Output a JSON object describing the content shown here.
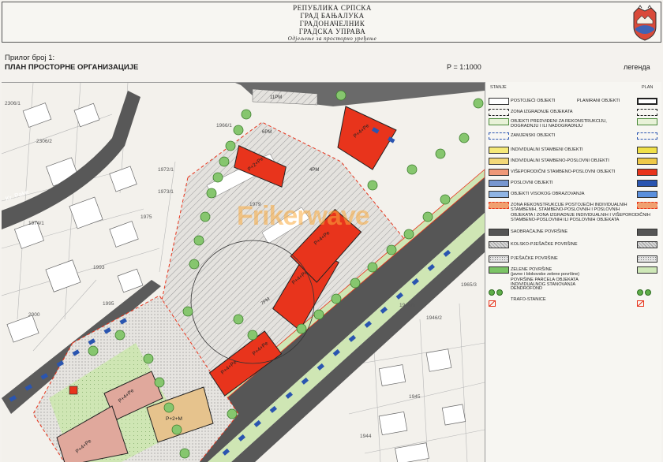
{
  "header": {
    "line1": "РЕПУБЛИКА СРПСКА",
    "line2": "ГРАД БАЊАЛУКА",
    "line3": "ГРАДОНАЧЕЛНИК",
    "line4": "ГРАДСКА УПРАВА",
    "line5": "Одјељење за просторно уређење"
  },
  "sheet": {
    "attachment": "Прилог број 1:",
    "title": "ПЛАН ПРОСТОРНЕ ОРГАНИЗАЦИЈЕ",
    "scale": "Р = 1:1000",
    "legend_label": "легенда"
  },
  "watermark": "Frikerwave",
  "map": {
    "parcels": [
      "2306/1",
      "2306/2",
      "1966/1",
      "1972/1",
      "1973/1",
      "1975",
      "1974/1",
      "1993",
      "1995",
      "2000",
      "1979",
      "1965/3",
      "1949/1",
      "1945",
      "1944",
      "1946/2"
    ],
    "street_label": "Kr. Pake",
    "building_labels": [
      "P+4+Pe",
      "P+2+Pe",
      "P+4+Pe",
      "P+4+Pe",
      "P+4+Pe",
      "P+4+Pe",
      "P+2+M",
      "P+4+Pe",
      "P+4+Pe"
    ],
    "parking_label": "11PM",
    "parking_label_2": "6PM",
    "parking_label_3": "4PM",
    "parking_label_4": "7PM"
  },
  "legend": {
    "col_existing": "STANJE",
    "col_plan": "PLAN",
    "items": [
      {
        "label": "POSTOJEĆI OBJEKTI",
        "label2": "PLANIRANI OBJEKTI",
        "fill": "#ffffff",
        "fill2": "#ffffff",
        "style": "outline"
      },
      {
        "label": "ZONA IZGRADNJE OBJEKATA",
        "fill": "none",
        "style": "dashed"
      },
      {
        "label": "OBJEKTI PREDVIĐENI ZA REKONSTRUKCIJU,\nDOGRADNJU I ILI NADOGRADNJU",
        "fill": "#e8f2d8",
        "style": "green-outline"
      },
      {
        "label": "ZAMJENSKI OBJEKTI",
        "fill": "none",
        "style": "blue-dashed"
      },
      {
        "label": "INDIVIDUALNI STAMBENI OBJEKTI",
        "fill": "#f5e978",
        "fill2": "#f0e048"
      },
      {
        "label": "INDIVIDUALNI STAMBENO-POSLOVNI OBJEKTI",
        "fill": "#f3d878",
        "fill2": "#eec848"
      },
      {
        "label": "VIŠEPORODIČNI STAMBENO-POSLOVNI OBJEKTI",
        "fill": "#ef9878",
        "fill2": "#e8341c"
      },
      {
        "label": "POSLOVNI OBJEKTI",
        "fill": "#7897d0",
        "fill2": "#2a55b0"
      },
      {
        "label": "OBJEKTI VISOKOG OBRAZOVANJA",
        "fill": "#8fb4e4",
        "fill2": "#5a8fdc"
      },
      {
        "label": "ZONA REKONSTRUKCIJE POSTOJEĆIH INDIVIDUALNIH\nSTAMBENIH, STAMBENO-POSLOVNIH I POSLOVNIH\nOBJEKATA I ZONA IZGRADNJE INDIVIDUALNIH I VIŠEPORODIČNIH\nSTAMBENO-POSLOVNIH ILI POSLOVNIH OBJEKATA",
        "fill": "#f0a070",
        "style": "red-dashed"
      },
      {
        "label": "SAOBRAĆAJNE POVRŠINE",
        "fill": "#555555"
      },
      {
        "label": "KOLSKO-PJEŠAČKE POVRŠINE",
        "fill": "#d8d8d8",
        "style": "hatch"
      },
      {
        "label": "PJEŠAČKE POVRŠINE",
        "fill": "#e4e4e4",
        "style": "dots"
      },
      {
        "label": "ZELENE POVRŠINE\n(javne i blokovske zelene površine)\nPOVRŠINE PARCELA OBJEKATA\nINDIVIDUALNOG STANOVANJA",
        "fill": "#7cc466",
        "fill2": "#cfe8b8"
      },
      {
        "label": "DENDROFOND",
        "fill": "#5fae4a",
        "style": "trees"
      },
      {
        "label": "TRAFO-STANICE",
        "fill": "#e8341c",
        "style": "trafo"
      }
    ]
  }
}
